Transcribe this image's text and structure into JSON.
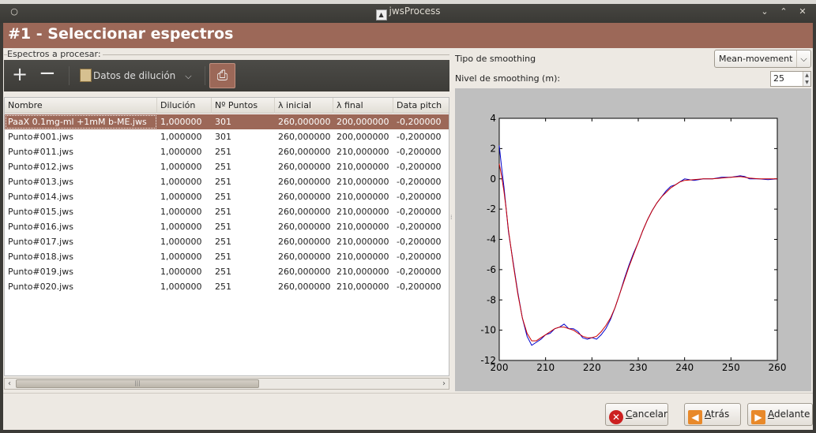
{
  "window": {
    "title": "jwsProcess"
  },
  "header": {
    "title": "#1 - Seleccionar espectros"
  },
  "left": {
    "group_label": "Espectros a procesar:",
    "toolbar": {
      "add": "+",
      "remove": "−",
      "dilution": "Datos de dilución"
    },
    "columns": [
      "Nombre",
      "Dilución",
      "Nº Puntos",
      "λ inicial",
      "λ final",
      "Data pitch"
    ],
    "rows": [
      [
        "PaaX 0.1mg-ml +1mM b-ME.jws",
        "1,000000",
        "301",
        "260,000000",
        "200,000000",
        "-0,200000"
      ],
      [
        "Punto#001.jws",
        "1,000000",
        "301",
        "260,000000",
        "200,000000",
        "-0,200000"
      ],
      [
        "Punto#011.jws",
        "1,000000",
        "251",
        "260,000000",
        "210,000000",
        "-0,200000"
      ],
      [
        "Punto#012.jws",
        "1,000000",
        "251",
        "260,000000",
        "210,000000",
        "-0,200000"
      ],
      [
        "Punto#013.jws",
        "1,000000",
        "251",
        "260,000000",
        "210,000000",
        "-0,200000"
      ],
      [
        "Punto#014.jws",
        "1,000000",
        "251",
        "260,000000",
        "210,000000",
        "-0,200000"
      ],
      [
        "Punto#015.jws",
        "1,000000",
        "251",
        "260,000000",
        "210,000000",
        "-0,200000"
      ],
      [
        "Punto#016.jws",
        "1,000000",
        "251",
        "260,000000",
        "210,000000",
        "-0,200000"
      ],
      [
        "Punto#017.jws",
        "1,000000",
        "251",
        "260,000000",
        "210,000000",
        "-0,200000"
      ],
      [
        "Punto#018.jws",
        "1,000000",
        "251",
        "260,000000",
        "210,000000",
        "-0,200000"
      ],
      [
        "Punto#019.jws",
        "1,000000",
        "251",
        "260,000000",
        "210,000000",
        "-0,200000"
      ],
      [
        "Punto#020.jws",
        "1,000000",
        "251",
        "260,000000",
        "210,000000",
        "-0,200000"
      ]
    ],
    "selected_row": 0
  },
  "right": {
    "smoothing_type_label": "Tipo de smoothing",
    "smoothing_type_value": "Mean-movement",
    "smoothing_level_label": "Nivel de smoothing (m):",
    "smoothing_level_value": "25"
  },
  "footer": {
    "cancel": {
      "first": "C",
      "rest": "ancelar"
    },
    "back": {
      "first": "A",
      "rest": "trás"
    },
    "next": {
      "first": "A",
      "rest": "delante"
    }
  },
  "colors": {
    "accent": "#9c6858",
    "raw_series": "#0000cc",
    "smoothed_series": "#cc0000"
  },
  "chart_data": {
    "type": "line",
    "xlim": [
      200,
      260
    ],
    "ylim": [
      -12,
      4
    ],
    "xticks": [
      200,
      210,
      220,
      230,
      240,
      250,
      260
    ],
    "yticks": [
      4,
      2,
      0,
      -2,
      -4,
      -6,
      -8,
      -10,
      -12
    ],
    "series": [
      {
        "x": [
          200,
          200.5,
          201,
          201.5,
          202,
          203,
          204,
          205,
          206,
          207,
          208,
          209,
          210,
          211,
          212,
          213,
          214,
          215,
          216,
          217,
          218,
          219,
          220,
          221,
          222,
          223,
          224,
          225,
          226,
          227,
          228,
          229,
          230,
          231,
          232,
          233,
          234,
          235,
          236,
          237,
          238,
          239,
          240,
          242,
          244,
          246,
          248,
          250,
          252,
          253,
          254,
          256,
          258,
          260
        ],
        "y": [
          2.2,
          0.8,
          -0.5,
          -2.0,
          -3.5,
          -5.5,
          -7.5,
          -9.2,
          -10.4,
          -11.0,
          -10.8,
          -10.6,
          -10.3,
          -10.2,
          -9.9,
          -9.8,
          -9.6,
          -9.9,
          -9.9,
          -10.1,
          -10.5,
          -10.6,
          -10.5,
          -10.6,
          -10.3,
          -9.9,
          -9.3,
          -8.5,
          -7.6,
          -6.6,
          -5.7,
          -4.9,
          -4.2,
          -3.4,
          -2.7,
          -2.1,
          -1.6,
          -1.2,
          -0.8,
          -0.5,
          -0.4,
          -0.2,
          0.0,
          -0.1,
          0.0,
          0.0,
          0.1,
          0.1,
          0.2,
          0.15,
          0.0,
          0.0,
          -0.05,
          0.0
        ]
      },
      {
        "x": [
          200,
          200.5,
          201,
          201.5,
          202,
          203,
          204,
          205,
          206,
          207,
          208,
          209,
          210,
          211,
          212,
          213,
          214,
          215,
          216,
          217,
          218,
          219,
          220,
          221,
          222,
          223,
          224,
          225,
          226,
          227,
          228,
          229,
          230,
          231,
          232,
          233,
          234,
          235,
          236,
          237,
          238,
          239,
          240,
          242,
          244,
          246,
          248,
          250,
          252,
          253,
          254,
          256,
          258,
          260
        ],
        "y": [
          1.0,
          0.2,
          -0.8,
          -2.0,
          -3.4,
          -5.6,
          -7.6,
          -9.2,
          -10.2,
          -10.7,
          -10.7,
          -10.5,
          -10.3,
          -10.1,
          -9.9,
          -9.8,
          -9.8,
          -9.9,
          -10.0,
          -10.2,
          -10.4,
          -10.5,
          -10.5,
          -10.4,
          -10.1,
          -9.7,
          -9.2,
          -8.5,
          -7.6,
          -6.7,
          -5.8,
          -5.0,
          -4.2,
          -3.4,
          -2.7,
          -2.1,
          -1.6,
          -1.2,
          -0.9,
          -0.6,
          -0.4,
          -0.2,
          -0.1,
          -0.05,
          0.0,
          0.0,
          0.05,
          0.1,
          0.15,
          0.1,
          0.05,
          0.0,
          0.0,
          0.0
        ]
      }
    ]
  }
}
